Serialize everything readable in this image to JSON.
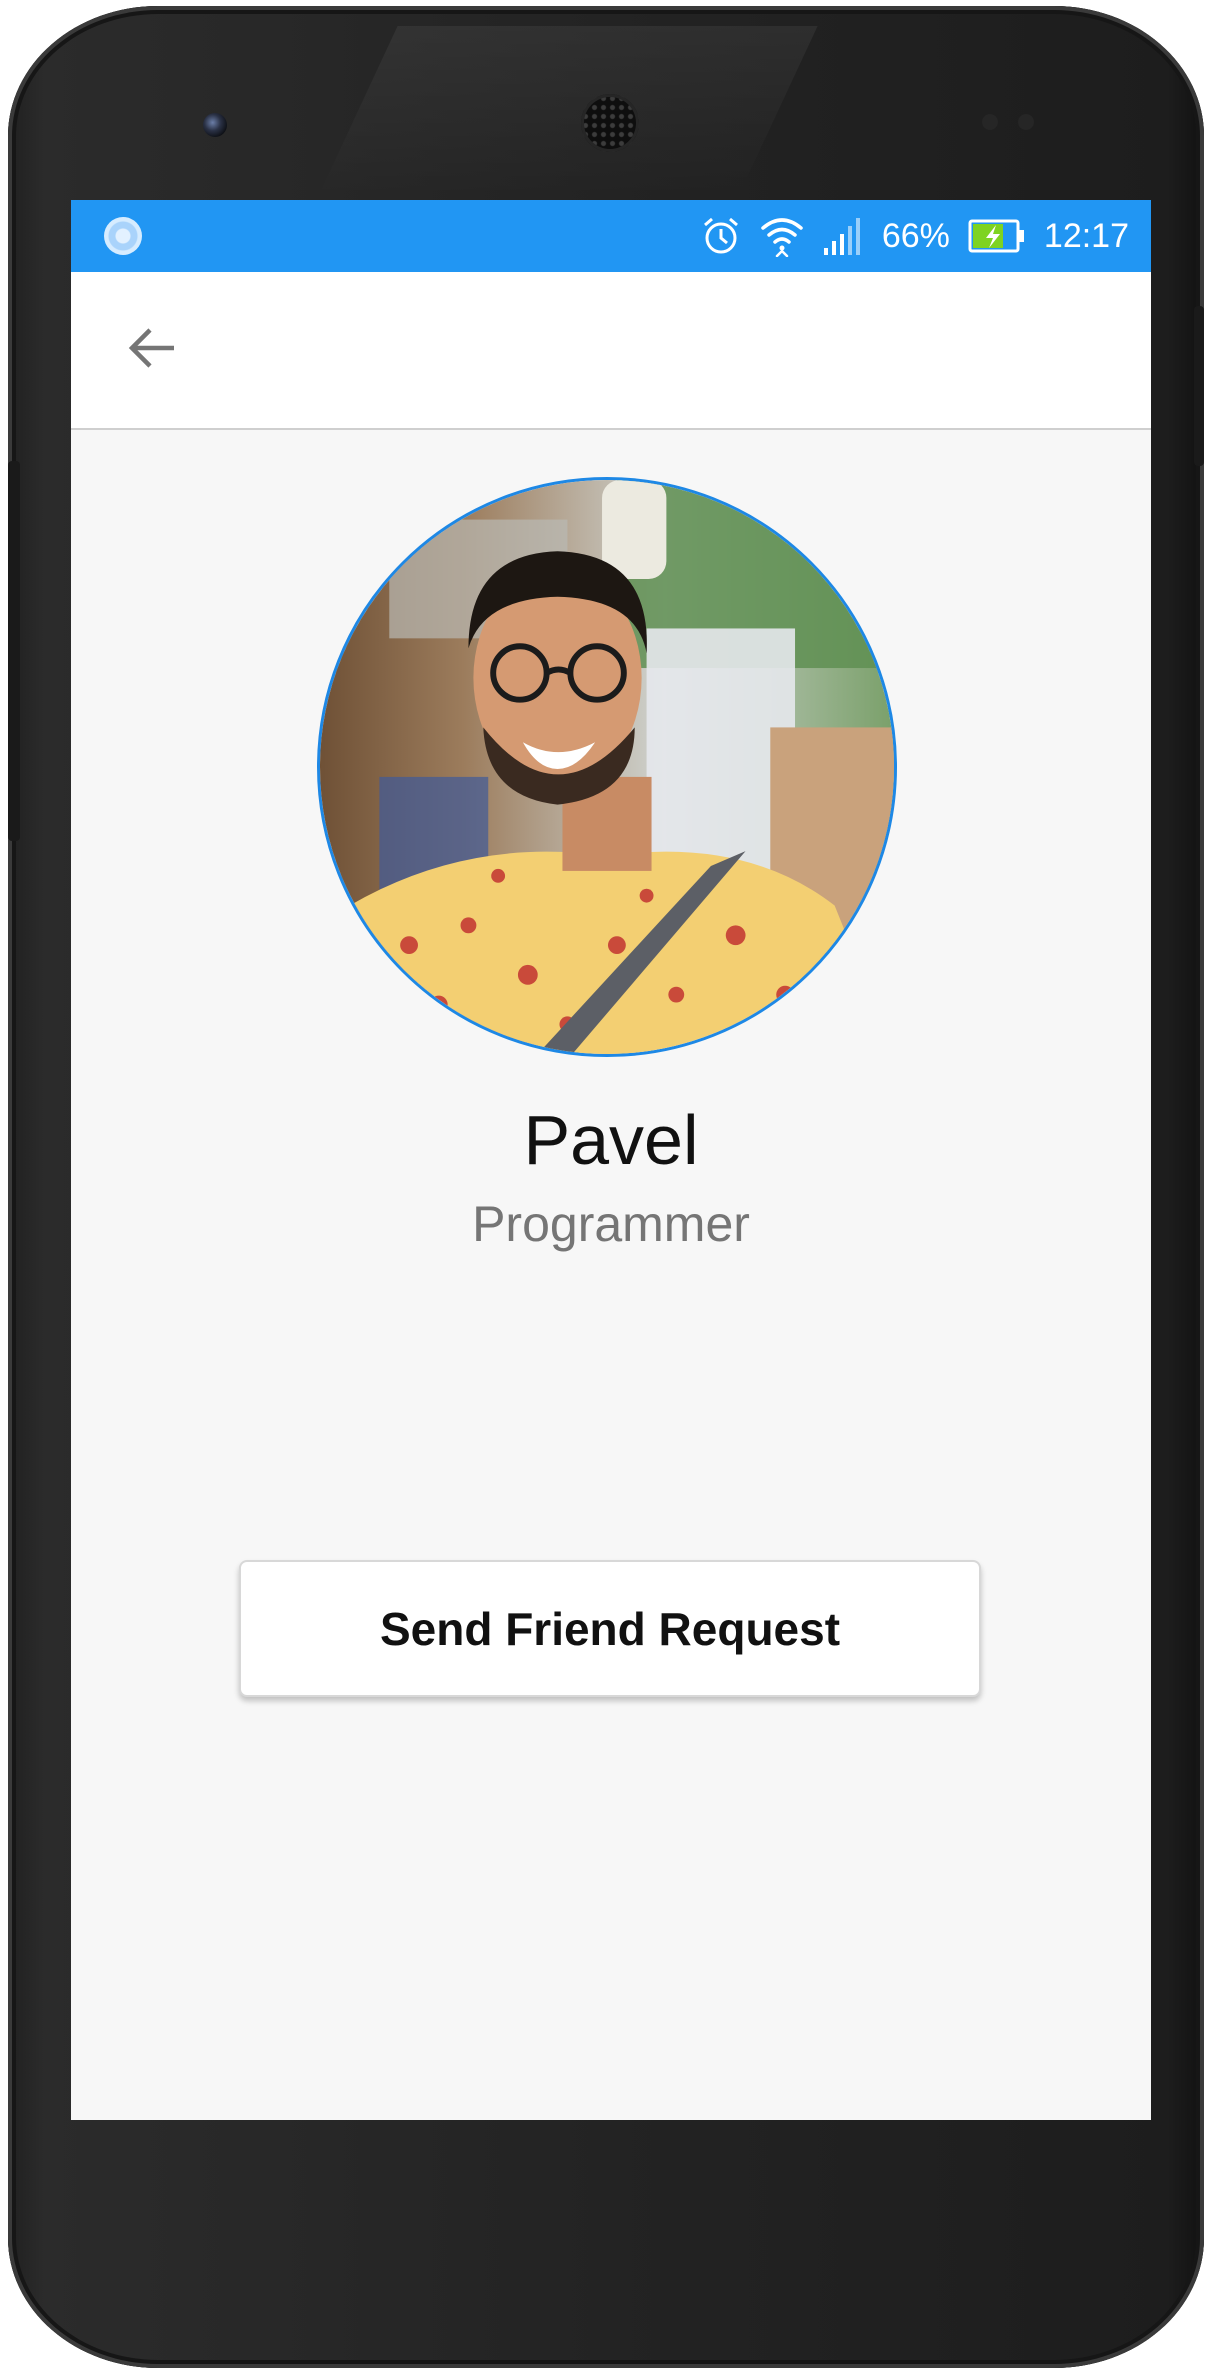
{
  "status_bar": {
    "battery_percent": "66%",
    "time": "12:17",
    "icons": [
      "notification-circle-icon",
      "alarm-icon",
      "wifi-icon",
      "signal-icon",
      "battery-charging-icon"
    ],
    "color": "#2196f3"
  },
  "app_bar": {
    "back_icon": "arrow-back-icon"
  },
  "profile": {
    "name": "Pavel",
    "role": "Programmer",
    "accent": "#1e88e5"
  },
  "actions": {
    "send_friend_request_label": "Send Friend Request"
  }
}
